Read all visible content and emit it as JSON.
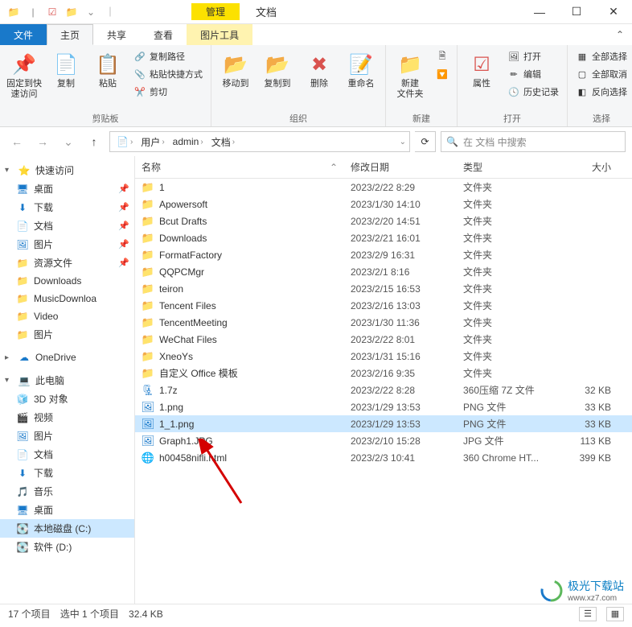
{
  "titlebar": {
    "context_tab": "管理",
    "title": "文档"
  },
  "tabs": {
    "file": "文件",
    "home": "主页",
    "share": "共享",
    "view": "查看",
    "pic_tools": "图片工具"
  },
  "ribbon": {
    "pin": {
      "label": "固定到快\n速访问"
    },
    "copy": {
      "label": "复制"
    },
    "paste": {
      "label": "粘贴"
    },
    "copy_path": "复制路径",
    "paste_shortcut": "粘贴快捷方式",
    "cut": "剪切",
    "group_clipboard": "剪贴板",
    "move_to": "移动到",
    "copy_to": "复制到",
    "delete": "删除",
    "rename": "重命名",
    "group_organize": "组织",
    "new_folder": "新建\n文件夹",
    "group_new": "新建",
    "properties": "属性",
    "open": "打开",
    "edit": "编辑",
    "history": "历史记录",
    "group_open": "打开",
    "select_all": "全部选择",
    "select_none": "全部取消",
    "invert_selection": "反向选择",
    "group_select": "选择"
  },
  "breadcrumb": {
    "items": [
      "用户",
      "admin",
      "文档"
    ]
  },
  "search": {
    "placeholder": "在 文档 中搜索"
  },
  "columns": {
    "name": "名称",
    "date": "修改日期",
    "type": "类型",
    "size": "大小"
  },
  "sidebar": {
    "quick_access": "快速访问",
    "desktop": "桌面",
    "downloads": "下载",
    "documents": "文档",
    "pictures": "图片",
    "resources": "资源文件",
    "downloads2": "Downloads",
    "music_dl": "MusicDownloa",
    "video": "Video",
    "pictures2": "图片",
    "onedrive": "OneDrive",
    "this_pc": "此电脑",
    "objects_3d": "3D 对象",
    "videos": "视频",
    "pictures3": "图片",
    "documents2": "文档",
    "downloads3": "下载",
    "music": "音乐",
    "desktop2": "桌面",
    "disk_c": "本地磁盘 (C:)",
    "disk_d": "软件 (D:)"
  },
  "files": [
    {
      "icon": "folder",
      "name": "1",
      "date": "2023/2/22 8:29",
      "type": "文件夹",
      "size": ""
    },
    {
      "icon": "folder",
      "name": "Apowersoft",
      "date": "2023/1/30 14:10",
      "type": "文件夹",
      "size": ""
    },
    {
      "icon": "folder",
      "name": "Bcut Drafts",
      "date": "2023/2/20 14:51",
      "type": "文件夹",
      "size": ""
    },
    {
      "icon": "folder",
      "name": "Downloads",
      "date": "2023/2/21 16:01",
      "type": "文件夹",
      "size": ""
    },
    {
      "icon": "folder",
      "name": "FormatFactory",
      "date": "2023/2/9 16:31",
      "type": "文件夹",
      "size": ""
    },
    {
      "icon": "folder",
      "name": "QQPCMgr",
      "date": "2023/2/1 8:16",
      "type": "文件夹",
      "size": ""
    },
    {
      "icon": "folder",
      "name": "teiron",
      "date": "2023/2/15 16:53",
      "type": "文件夹",
      "size": ""
    },
    {
      "icon": "folder",
      "name": "Tencent Files",
      "date": "2023/2/16 13:03",
      "type": "文件夹",
      "size": ""
    },
    {
      "icon": "folder",
      "name": "TencentMeeting",
      "date": "2023/1/30 11:36",
      "type": "文件夹",
      "size": ""
    },
    {
      "icon": "folder",
      "name": "WeChat Files",
      "date": "2023/2/22 8:01",
      "type": "文件夹",
      "size": ""
    },
    {
      "icon": "folder",
      "name": "XneoYs",
      "date": "2023/1/31 15:16",
      "type": "文件夹",
      "size": ""
    },
    {
      "icon": "folder",
      "name": "自定义 Office 模板",
      "date": "2023/2/16 9:35",
      "type": "文件夹",
      "size": ""
    },
    {
      "icon": "archive",
      "name": "1.7z",
      "date": "2023/2/22 8:28",
      "type": "360压缩 7Z 文件",
      "size": "32 KB"
    },
    {
      "icon": "image",
      "name": "1.png",
      "date": "2023/1/29 13:53",
      "type": "PNG 文件",
      "size": "33 KB"
    },
    {
      "icon": "image",
      "name": "1_1.png",
      "date": "2023/1/29 13:53",
      "type": "PNG 文件",
      "size": "33 KB",
      "selected": true
    },
    {
      "icon": "image",
      "name": "Graph1.JPG",
      "date": "2023/2/10 15:28",
      "type": "JPG 文件",
      "size": "113 KB"
    },
    {
      "icon": "html",
      "name": "h00458nifli.html",
      "date": "2023/2/3 10:41",
      "type": "360 Chrome HT...",
      "size": "399 KB"
    }
  ],
  "statusbar": {
    "count": "17 个项目",
    "selected": "选中 1 个项目",
    "size": "32.4 KB"
  },
  "watermark": {
    "text": "极光下载站",
    "url": "www.xz7.com"
  }
}
